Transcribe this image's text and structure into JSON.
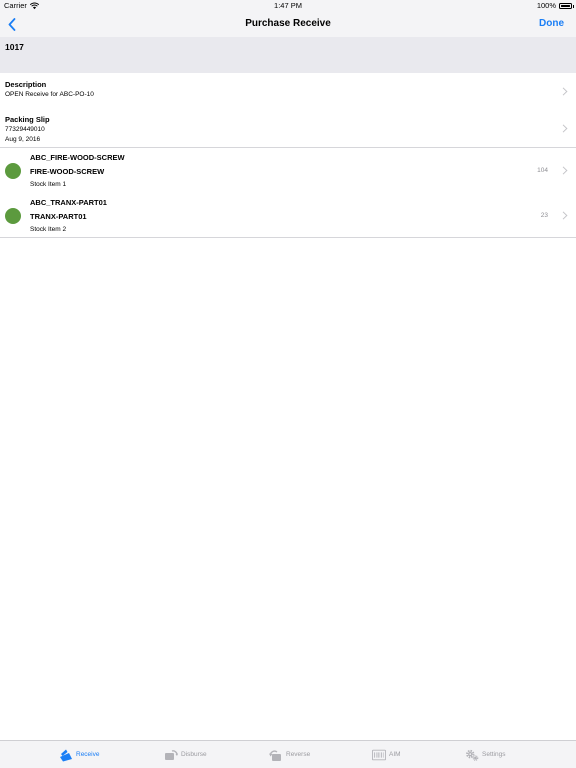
{
  "status_bar": {
    "carrier": "Carrier",
    "time": "1:47 PM",
    "battery": "100%"
  },
  "nav": {
    "title": "Purchase Receive",
    "done_label": "Done"
  },
  "header": {
    "po_number": "1017"
  },
  "description": {
    "label": "Description",
    "value": "OPEN Receive for ABC-PO-10"
  },
  "packing_slip": {
    "label": "Packing Slip",
    "number": "77329449010",
    "date": "Aug 9, 2016"
  },
  "items": [
    {
      "code": "ABC_FIRE-WOOD-SCREW",
      "name": "FIRE-WOOD-SCREW",
      "subtitle": "Stock Item 1",
      "quantity": "104",
      "status_color": "#5c9a3e"
    },
    {
      "code": "ABC_TRANX-PART01",
      "name": "TRANX-PART01",
      "subtitle": "Stock Item 2",
      "quantity": "23",
      "status_color": "#5c9a3e"
    }
  ],
  "tabs": [
    {
      "label": "Receive",
      "icon": "receive-icon",
      "active": true
    },
    {
      "label": "Disburse",
      "icon": "disburse-icon",
      "active": false
    },
    {
      "label": "Reverse",
      "icon": "reverse-icon",
      "active": false
    },
    {
      "label": "AIM",
      "icon": "aim-icon",
      "active": false
    },
    {
      "label": "Settings",
      "icon": "settings-icon",
      "active": false
    }
  ],
  "colors": {
    "accent": "#1a7ef5",
    "status_ok": "#5c9a3e",
    "inactive": "#9b9ba0"
  }
}
